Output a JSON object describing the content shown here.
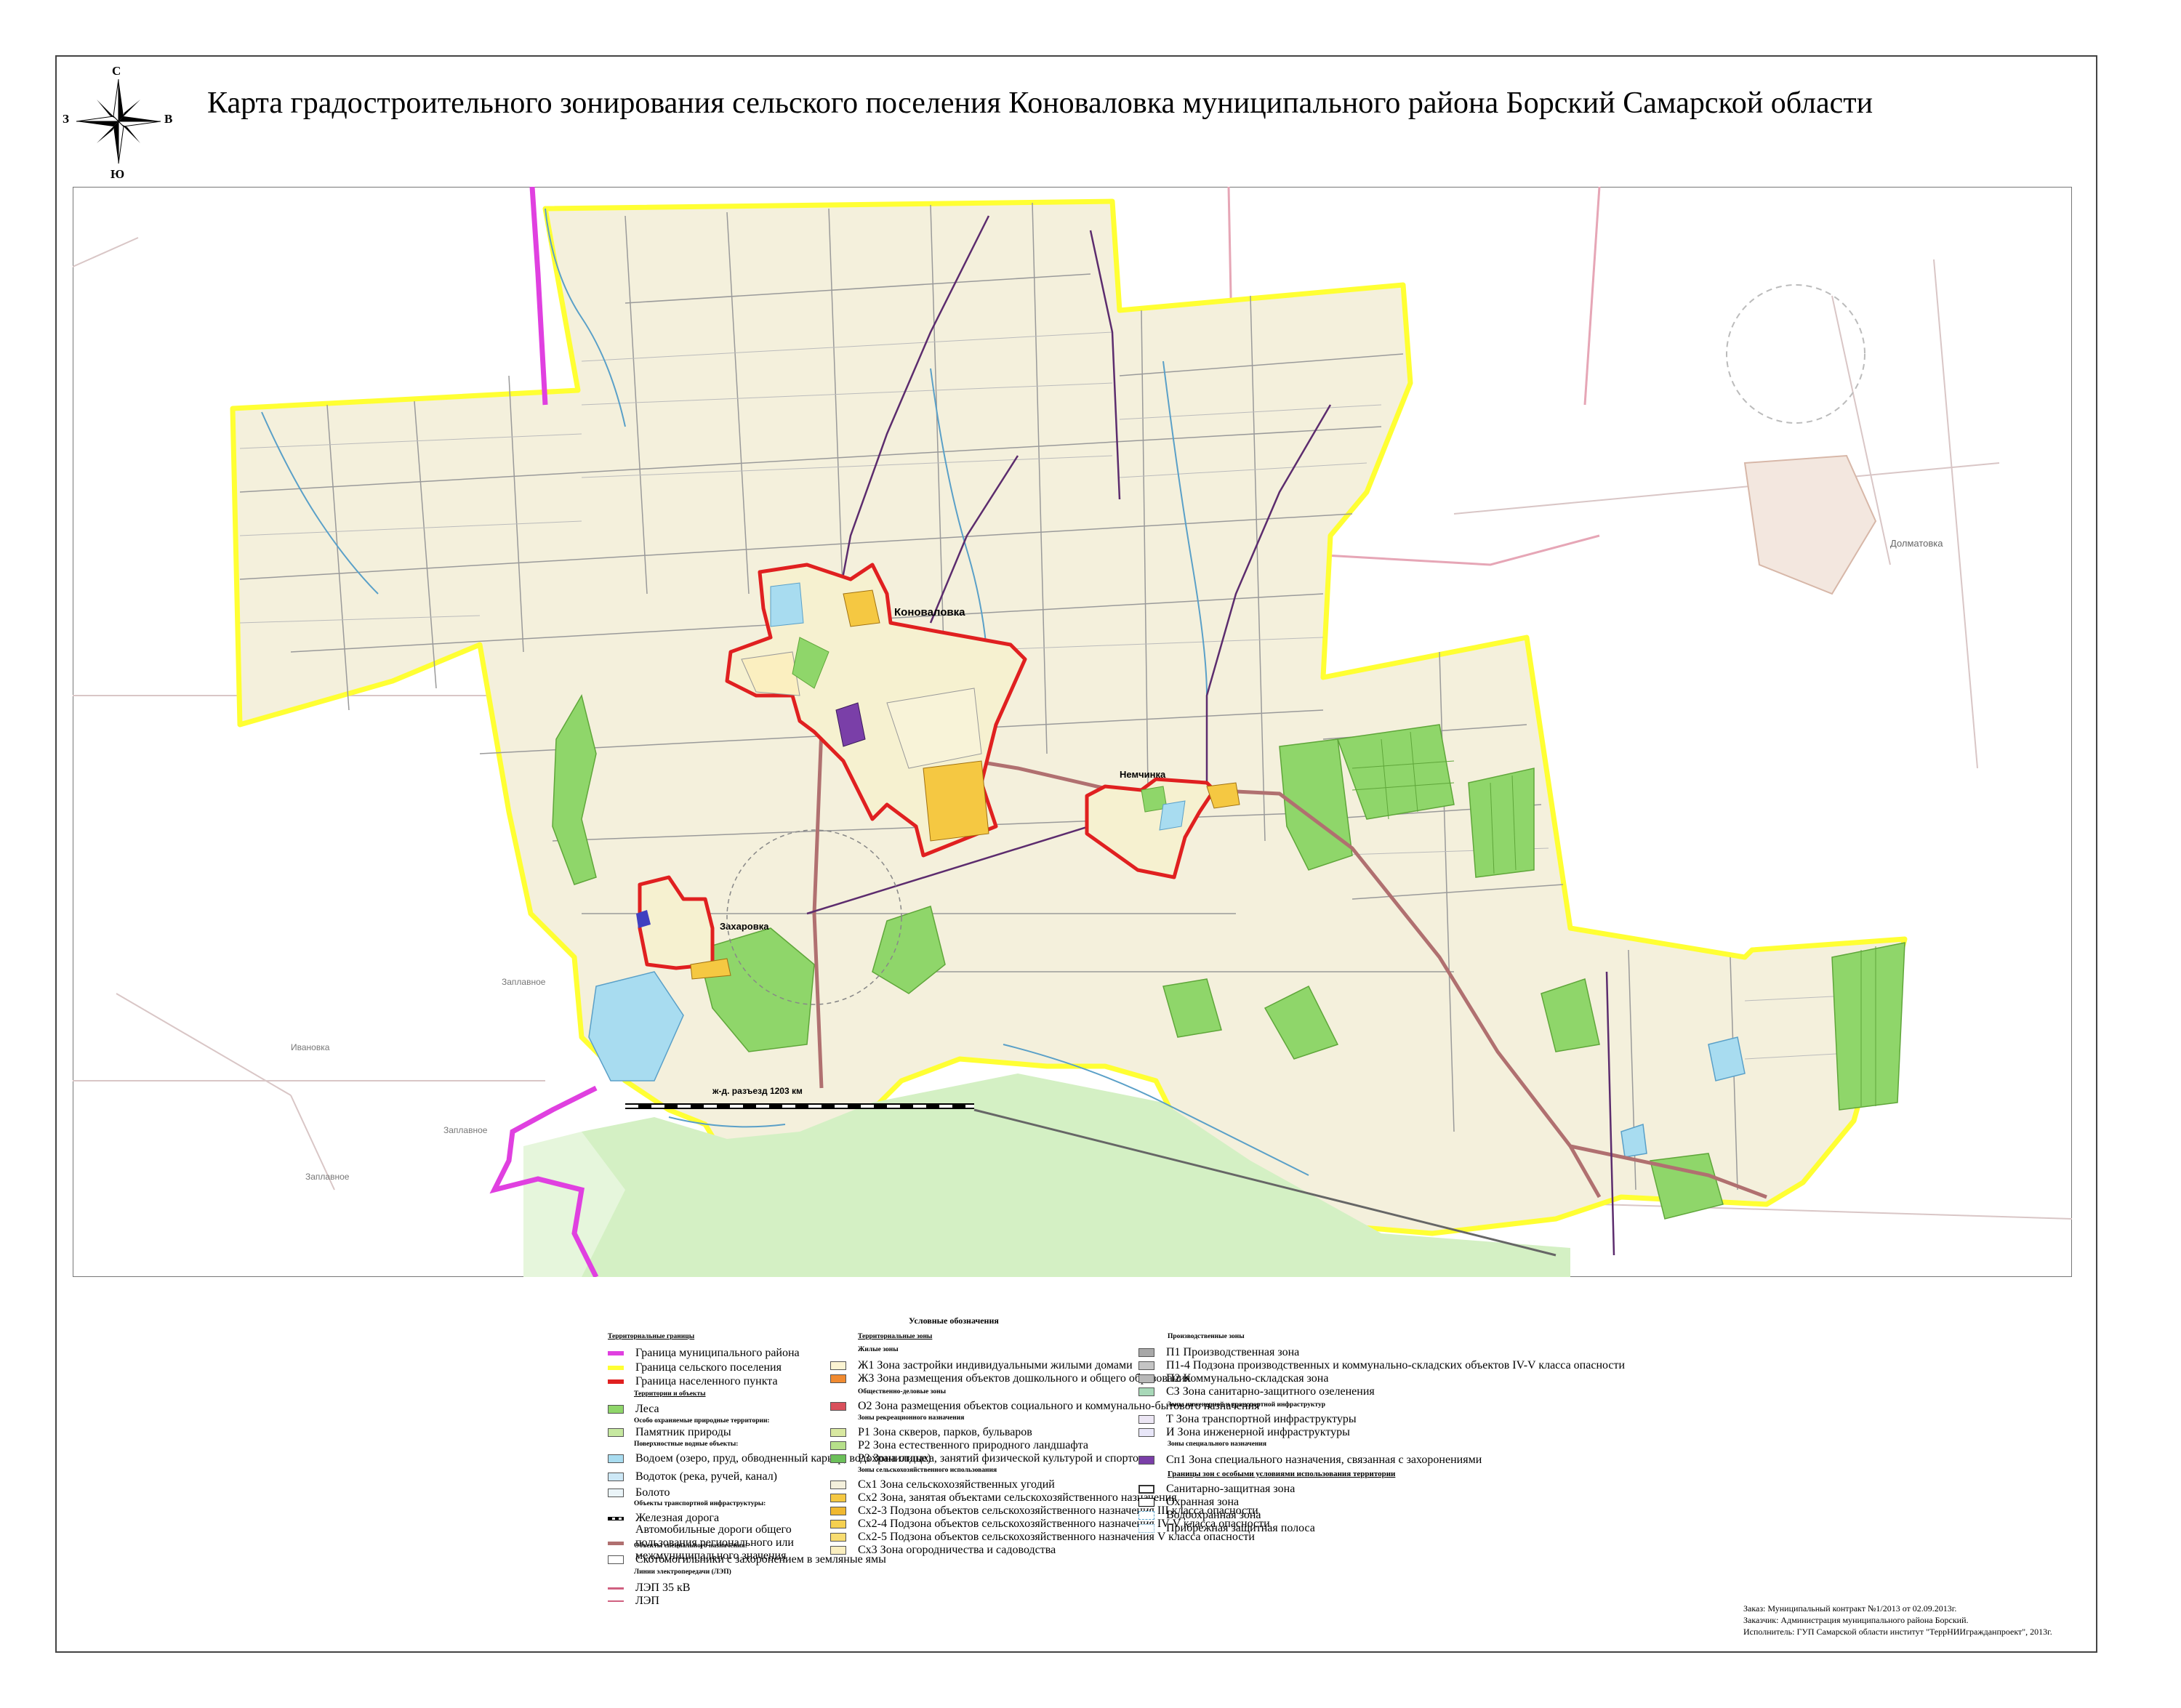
{
  "title": "Карта градостроительного зонирования сельского поселения Коноваловка муниципального района Борский Самарской области",
  "compass": {
    "north": "С",
    "south": "Ю",
    "west": "З",
    "east": "В"
  },
  "map_labels": {
    "konovalovka": "Коноваловка",
    "nemchinka": "Немчинка",
    "zakharovka": "Захаровка",
    "station": "ж-д. разъезд 1203 км",
    "dolmatovka": "Долматовка",
    "ivanovka": "Ивановка",
    "zaplavnoe1": "Заплавное",
    "zaplavnoe2": "Заплавное",
    "zaplavnoe3": "Заплавное"
  },
  "legend": {
    "title": "Условные обозначения",
    "col1": {
      "territorial_boundaries": "Территориальные границы",
      "b1": "Граница муниципального района",
      "b2": "Граница сельского поселения",
      "b3": "Граница населенного пункта",
      "territories_objects": "Территории и объекты",
      "forests": "Леса",
      "protected_head": "Особо охраняемые природные территории:",
      "nature_monument": "Памятник природы",
      "water_head": "Поверхностные водные объекты:",
      "water1": "Водоем (озеро, пруд, обводненный карьер, водохранилище)",
      "water2": "Водоток (река, ручей, канал)",
      "swamp": "Болото",
      "transport_head": "Объекты транспортной инфраструктуры:",
      "railway": "Железная дорога",
      "road": "Автомобильные дороги общего пользования регионального или межмуниципального значения",
      "special_head": "Объекты специального назначения:",
      "cattle_burial": "Скотомогильники с захоронением в земляные ямы",
      "power_head": "Линии электропередачи (ЛЭП)",
      "pl35": "ЛЭП 35 кВ",
      "pl10": "ЛЭП"
    },
    "col2": {
      "zones_head": "Территориальные зоны",
      "residential": "Жилые зоны",
      "zh1": "Ж1    Зона застройки индивидуальными жилыми домами",
      "zh3": "Ж3    Зона размещения объектов дошкольного и общего образования",
      "public": "Общественно-деловые зоны",
      "o2": "О2    Зона размещения объектов социального и коммунально-бытового назначения",
      "recreation": "Зоны рекреационного назначения",
      "r1": "Р1    Зона скверов, парков, бульваров",
      "r2": "Р2    Зона естественного природного ландшафта",
      "r3": "Р3    Зона отдыха, занятий физической культурой и спортом",
      "agri": "Зоны сельскохозяйственного использования",
      "sh1": "Сх1    Зона сельскохозяйственных угодий",
      "sh2": "Сх2    Зона, занятая объектами сельскохозяйственного назначения",
      "sh23": "Сх2-3 Подзона объектов сельскохозяйственного назначения III класса опасности",
      "sh24": "Сх2-4 Подзона объектов сельскохозяйственного назначения IV-V класса опасности",
      "sh25": "Сх2-5 Подзона объектов сельскохозяйственного назначения V класса опасности",
      "sh3": "Сх3    Зона огородничества и садоводства"
    },
    "col3": {
      "production": "Производственные зоны",
      "p1": "П1    Производственная зона",
      "p14": "П1-4 Подзона производственных и коммунально-складских объектов IV-V класса опасности",
      "p2": "П2    Коммунально-складская зона",
      "sz": "СЗ    Зона санитарно-защитного озеленения",
      "infra": "Зоны инженерной и транспортной инфраструктур",
      "t": "Т    Зона транспортной инфраструктуры",
      "i": "И    Зона инженерной инфраструктуры",
      "special": "Зоны специального назначения",
      "sp1": "Сп1   Зона специального назначения, связанная с захоронениями",
      "borders": "Границы зон с особыми условиями использования территории",
      "sanitary": "Санитарно-защитная зона",
      "security": "Охранная зона",
      "water_protection": "Водоохранная зона",
      "coastal": "Прибрежная защитная полоса"
    }
  },
  "order_info": {
    "line1": "Заказ: Муниципальный контракт №1/2013 от 02.09.2013г.",
    "line2": "Заказчик: Администрация муниципального района Борский.",
    "line3": "Исполнитель: ГУП Самарской области институт \"ТеррНИИгражданпроект\", 2013г."
  },
  "colors": {
    "district_boundary": "#e040e0",
    "settlement_boundary": "#ffff33",
    "locality_boundary": "#e02020",
    "agri_land": "#f4f0dc",
    "forest": "#8fd66a",
    "water": "#a8dcf0"
  }
}
